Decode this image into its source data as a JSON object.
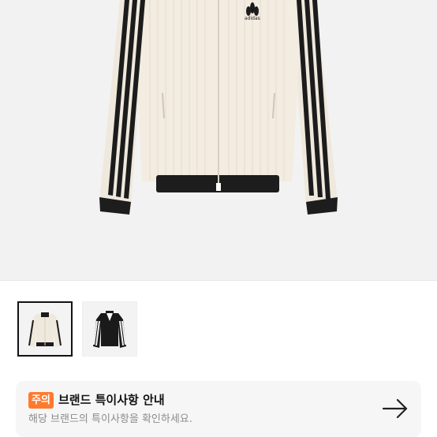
{
  "product": {
    "brand_logo_text": "adidas",
    "hero_image": "white-corduroy-track-jacket",
    "thumbnails": [
      {
        "image": "white-track-jacket-thumbnail",
        "selected": true
      },
      {
        "image": "black-track-jacket-thumbnail",
        "selected": false
      }
    ]
  },
  "notice": {
    "badge": "주의",
    "title": "브랜드 특이사항 안내",
    "description": "해당 브랜드의 특이사항을 확인하세요.",
    "arrow_icon": "arrow-right-icon"
  },
  "colors": {
    "badge_bg": "#ff7a2f",
    "notice_bg": "#f6f6f6",
    "hero_bg": "#f2f2f2"
  }
}
